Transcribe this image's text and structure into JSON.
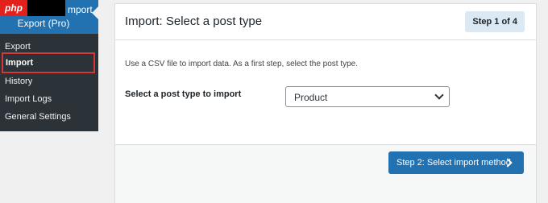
{
  "sidebar": {
    "logo_text": "php",
    "header_line1": "mport",
    "header_line2": "Export (Pro)",
    "items": [
      {
        "label": "Export"
      },
      {
        "label": "Import"
      },
      {
        "label": "History"
      },
      {
        "label": "Import Logs"
      },
      {
        "label": "General Settings"
      }
    ],
    "active_item": "Import"
  },
  "card": {
    "title": "Import: Select a post type",
    "step_badge": "Step 1 of 4",
    "description": "Use a CSV file to import data. As a first step, select the post type.",
    "field_label": "Select a post type to import",
    "post_type_select": {
      "selected": "Product"
    },
    "next_button": {
      "label": "Step 2: Select import method",
      "icon": "chevron-right-icon"
    }
  },
  "colors": {
    "sidebar_bg": "#2c3338",
    "sidebar_header_bg": "#2271b1",
    "active_outline": "#d63638",
    "primary": "#2271b1",
    "badge_bg": "#dbe9f4",
    "page_bg": "#f0f0f1"
  }
}
